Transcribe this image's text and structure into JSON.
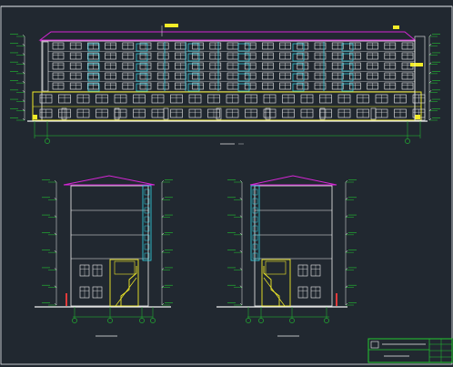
{
  "drawing": {
    "colors": {
      "background": "#212830",
      "frame": "#e9ecef",
      "linework": "#f1f1f1",
      "cyan": "#33d6e8",
      "yellow": "#f2ec28",
      "green": "#22c831",
      "magenta": "#d526d5",
      "red": "#e23a3a"
    },
    "views": [
      {
        "id": "front-elevation",
        "title": "",
        "scale": ""
      },
      {
        "id": "left-side-elevation",
        "title": "",
        "scale": ""
      },
      {
        "id": "right-side-elevation",
        "title": "",
        "scale": ""
      }
    ],
    "title_block": {
      "project": "",
      "drawing_name": "",
      "drawing_no": ""
    }
  }
}
